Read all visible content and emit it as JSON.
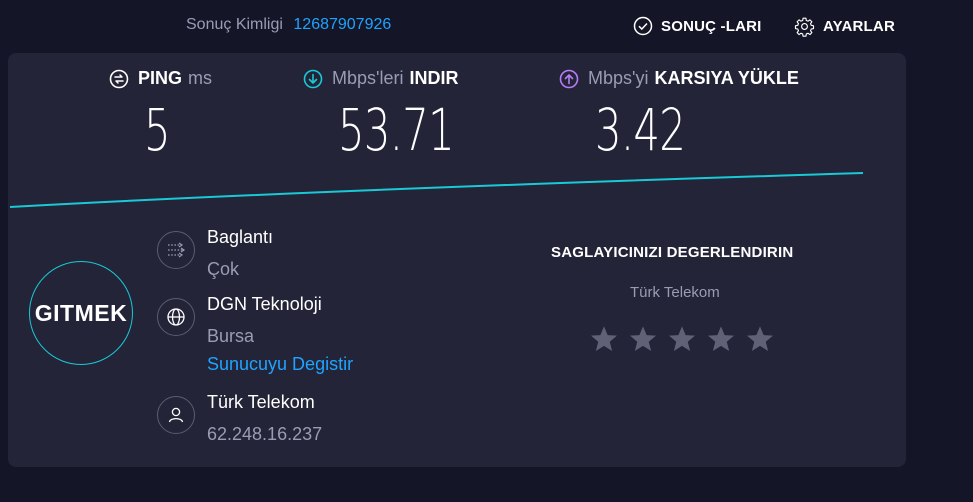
{
  "header": {
    "result_id_label": "Sonuç Kimligi",
    "result_id_value": "12687907926",
    "results_label": "SONUÇ -LARI",
    "settings_label": "AYARLAR"
  },
  "metrics": {
    "ping": {
      "name": "PING",
      "unit": "ms",
      "value": "5",
      "icon": "ping-icon"
    },
    "download": {
      "unit": "Mbps'leri",
      "name": "INDIR",
      "value": "53.71",
      "icon": "download-arrow-icon"
    },
    "upload": {
      "unit": "Mbps'yi",
      "name": "KARSIYA YÜKLE",
      "value": "3.42",
      "icon": "upload-arrow-icon"
    }
  },
  "go_label": "GITMEK",
  "connection": {
    "title": "Baglantı",
    "value": "Çok"
  },
  "server": {
    "name": "DGN Teknoloji",
    "location": "Bursa",
    "change_label": "Sunucuyu Degistir"
  },
  "isp": {
    "name": "Türk Telekom",
    "ip": "62.248.16.237"
  },
  "rating": {
    "title": "SAGLAYICINIZI DEGERLENDIRIN",
    "provider": "Türk Telekom",
    "stars": 5
  },
  "colors": {
    "background": "#141526",
    "panel": "#232437",
    "accent_cyan": "#19c9d6",
    "link_blue": "#1fa3ff",
    "upload_purple": "#b97cf7",
    "muted_text": "#9a9cb6",
    "star": "#5f6177"
  }
}
